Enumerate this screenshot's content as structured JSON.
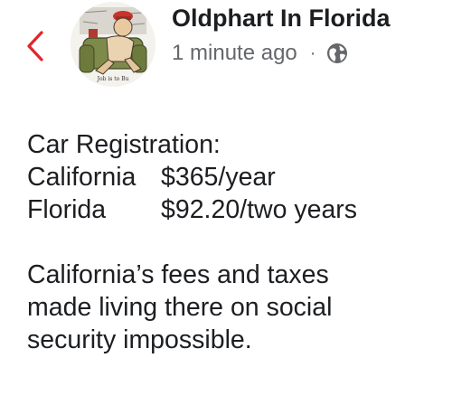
{
  "header": {
    "author_name": "Oldphart In Florida",
    "timestamp": "1 minute ago",
    "separator": "·",
    "audience_icon": "globe-icon",
    "back_icon": "chevron-left-icon",
    "avatar_caption": "Job is to Bu",
    "accent_color": "#e4242b"
  },
  "post": {
    "heading": "Car Registration:",
    "rows": [
      {
        "state": "California",
        "fee": "$365/year"
      },
      {
        "state": "Florida",
        "fee": "$92.20/two years"
      }
    ],
    "paragraph_lines": [
      "California’s fees and taxes",
      "made living there on social",
      "security impossible."
    ]
  }
}
